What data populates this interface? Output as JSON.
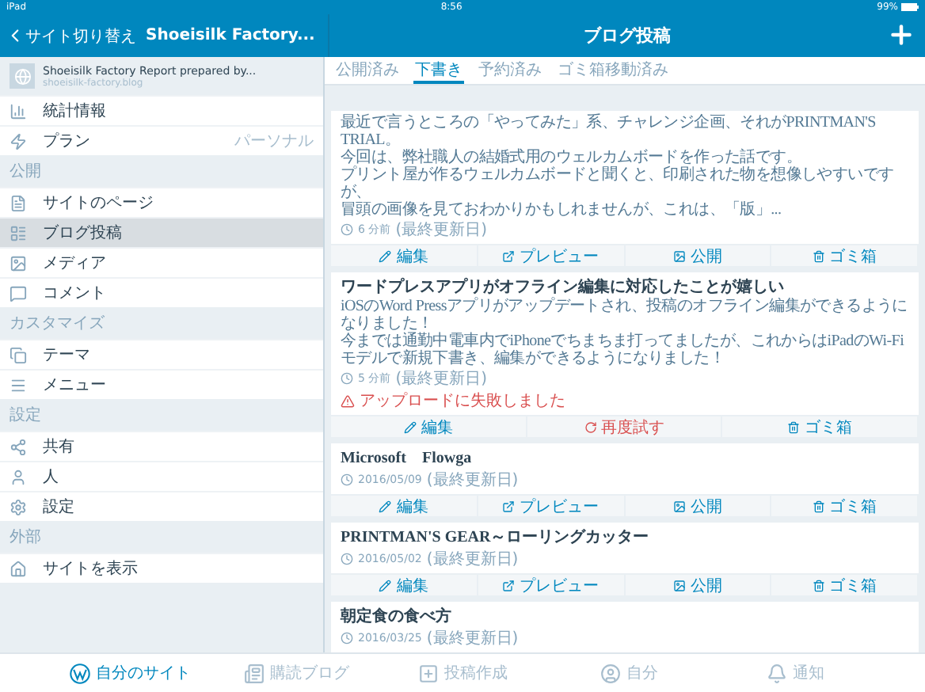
{
  "status_bar": {
    "device": "iPad",
    "time": "8:56",
    "battery": "99%"
  },
  "sidebar": {
    "back_label": "サイト切り替え",
    "site_title": "Shoeisilk Factory...",
    "site_name": "Shoeisilk Factory Report prepared by...",
    "site_url": "shoeisilk-factory.blog",
    "groups": [
      {
        "items": [
          {
            "kind": "stats",
            "label": "統計情報",
            "selected": false
          },
          {
            "kind": "plan",
            "label": "プラン",
            "value": "パーソナル",
            "selected": false
          }
        ]
      },
      {
        "heading": "公開",
        "items": [
          {
            "kind": "pages",
            "label": "サイトのページ",
            "selected": false
          },
          {
            "kind": "posts",
            "label": "ブログ投稿",
            "selected": true
          },
          {
            "kind": "media",
            "label": "メディア",
            "selected": false
          },
          {
            "kind": "comments",
            "label": "コメント",
            "selected": false
          }
        ]
      },
      {
        "heading": "カスタマイズ",
        "items": [
          {
            "kind": "themes",
            "label": "テーマ",
            "selected": false
          },
          {
            "kind": "menus",
            "label": "メニュー",
            "selected": false
          }
        ]
      },
      {
        "heading": "設定",
        "items": [
          {
            "kind": "sharing",
            "label": "共有",
            "selected": false
          },
          {
            "kind": "people",
            "label": "人",
            "selected": false
          },
          {
            "kind": "settings",
            "label": "設定",
            "selected": false
          }
        ]
      },
      {
        "heading": "外部",
        "items": [
          {
            "kind": "view",
            "label": "サイトを表示",
            "selected": false
          }
        ]
      }
    ]
  },
  "main": {
    "title": "ブログ投稿",
    "tabs": [
      {
        "label": "公開済み",
        "selected": false
      },
      {
        "label": "下書き",
        "selected": true
      },
      {
        "label": "予約済み",
        "selected": false
      },
      {
        "label": "ゴミ箱移動済み",
        "selected": false
      }
    ],
    "posts": [
      {
        "excerpt": [
          "最近で言うところの「やってみた」系、チャレンジ企画、それがPRINTMAN'S TRIAL。",
          "今回は、弊社職人の結婚式用のウェルカムボードを作った話です。",
          "プリント屋が作るウェルカムボードと聞くと、印刷された物を想像しやすいですが、",
          "冒頭の画像を見ておわかりかもしれませんが、これは、「版」..."
        ],
        "time": "6 分前",
        "note": "(最終更新日)",
        "actions": [
          {
            "kind": "edit",
            "label": "編集"
          },
          {
            "kind": "preview",
            "label": "プレビュー"
          },
          {
            "kind": "publish",
            "label": "公開"
          },
          {
            "kind": "trash",
            "label": "ゴミ箱"
          }
        ]
      },
      {
        "title": "ワードプレスアプリがオフライン編集に対応したことが嬉しい",
        "excerpt": [
          "iOSのWord Pressアプリがアップデートされ、投稿のオフライン編集ができるようになりました！",
          "今までは通勤中電車内でiPhoneでちまちま打ってましたが、これからはiPadのWi-Fiモデルで新規下書き、編集ができるようになりました！"
        ],
        "time": "5 分前",
        "note": "(最終更新日)",
        "error": "アップロードに失敗しました",
        "actions": [
          {
            "kind": "edit",
            "label": "編集"
          },
          {
            "kind": "retry",
            "label": "再度試す"
          },
          {
            "kind": "trash",
            "label": "ゴミ箱"
          }
        ]
      },
      {
        "title": "Microsoft　Flowga",
        "time": "2016/05/09",
        "note": "(最終更新日)",
        "actions": [
          {
            "kind": "edit",
            "label": "編集"
          },
          {
            "kind": "preview",
            "label": "プレビュー"
          },
          {
            "kind": "publish",
            "label": "公開"
          },
          {
            "kind": "trash",
            "label": "ゴミ箱"
          }
        ]
      },
      {
        "title": "PRINTMAN'S GEAR～ローリングカッター",
        "time": "2016/05/02",
        "note": "(最終更新日)",
        "actions": [
          {
            "kind": "edit",
            "label": "編集"
          },
          {
            "kind": "preview",
            "label": "プレビュー"
          },
          {
            "kind": "publish",
            "label": "公開"
          },
          {
            "kind": "trash",
            "label": "ゴミ箱"
          }
        ]
      },
      {
        "title": "朝定食の食べ方",
        "time": "2016/03/25",
        "note": "(最終更新日)"
      }
    ]
  },
  "tab_bar": [
    {
      "kind": "my-site",
      "label": "自分のサイト",
      "selected": true
    },
    {
      "kind": "reader",
      "label": "購読ブログ",
      "selected": false
    },
    {
      "kind": "write",
      "label": "投稿作成",
      "selected": false
    },
    {
      "kind": "me",
      "label": "自分",
      "selected": false
    },
    {
      "kind": "notifications",
      "label": "通知",
      "selected": false
    }
  ]
}
